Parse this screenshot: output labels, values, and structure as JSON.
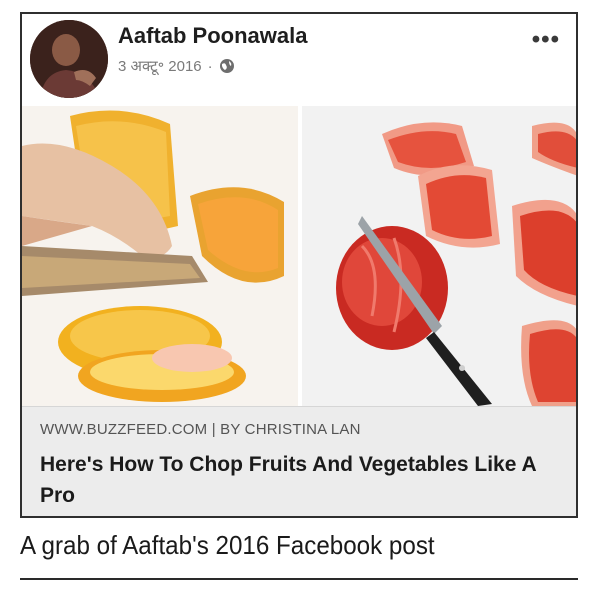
{
  "post": {
    "author": "Aaftab Poonawala",
    "date": "3 अक्टू॰ 2016",
    "separator": "·",
    "more_label": "•••",
    "privacy_icon": "globe-icon"
  },
  "link_preview": {
    "source": "WWW.BUZZFEED.COM | BY CHRISTINA LAN",
    "title": "Here's How To Chop Fruits And Vegetables Like A Pro"
  },
  "caption": "A grab of Aaftab's 2016 Facebook post",
  "colors": {
    "border": "#2f2f2f",
    "link_bg": "#ececec",
    "meta_text": "#7a7a7a"
  }
}
